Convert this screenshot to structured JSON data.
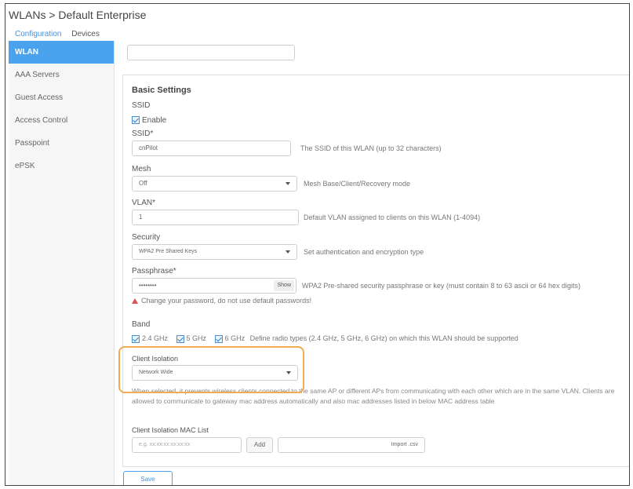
{
  "header": {
    "breadcrumb": "WLANs > Default Enterprise",
    "tabs": [
      {
        "label": "Configuration",
        "active": true
      },
      {
        "label": "Devices",
        "active": false
      }
    ]
  },
  "sidebar": {
    "items": [
      {
        "label": "WLAN",
        "active": true
      },
      {
        "label": "AAA Servers",
        "active": false
      },
      {
        "label": "Guest Access",
        "active": false
      },
      {
        "label": "Access Control",
        "active": false
      },
      {
        "label": "Passpoint",
        "active": false
      },
      {
        "label": "ePSK",
        "active": false
      }
    ]
  },
  "basic": {
    "section_title": "Basic Settings",
    "ssid_group_label": "SSID",
    "enable_label": "Enable",
    "enable_checked": true,
    "ssid_label": "SSID*",
    "ssid_value": "cnPilot",
    "ssid_help": "The SSID of this WLAN (up to 32 characters)",
    "mesh_label": "Mesh",
    "mesh_value": "Off",
    "mesh_help": "Mesh Base/Client/Recovery mode",
    "vlan_label": "VLAN*",
    "vlan_value": "1",
    "vlan_help": "Default VLAN assigned to clients on this WLAN (1-4094)",
    "security_label": "Security",
    "security_value": "WPA2 Pre Shared Keys",
    "security_help": "Set authentication and encryption type",
    "passphrase_label": "Passphrase*",
    "passphrase_value": "••••••••",
    "show_label": "Show",
    "passphrase_help": "WPA2 Pre-shared security passphrase or key (must contain 8 to 63 ascii or 64 hex digits)",
    "warning_text": "Change your password, do not use default passwords!",
    "band_label": "Band",
    "band_options": [
      {
        "label": "2.4 GHz",
        "checked": true
      },
      {
        "label": "5 GHz",
        "checked": true
      },
      {
        "label": "6 GHz",
        "checked": true
      }
    ],
    "band_help": "Define radio types (2.4 GHz, 5 GHz, 6 GHz) on which this WLAN should be supported",
    "client_isolation_label": "Client Isolation",
    "client_isolation_value": "Network Wide",
    "client_isolation_help": "When selected, it prevents wireless clients connected to the same AP or different APs from communicating with each other which are in the same VLAN. Clients are allowed to communicate to gateway mac address automatically and also mac addresses listed in below MAC address table",
    "mac_list_label": "Client Isolation MAC List",
    "mac_placeholder": "e.g. xx:xx:xx:xx:xx:xx",
    "add_label": "Add",
    "import_label": "Import .csv"
  },
  "footer": {
    "save_label": "Save"
  },
  "colors": {
    "accent": "#4aa3ec",
    "highlight": "#f0ad4e",
    "warning": "#e05252"
  }
}
